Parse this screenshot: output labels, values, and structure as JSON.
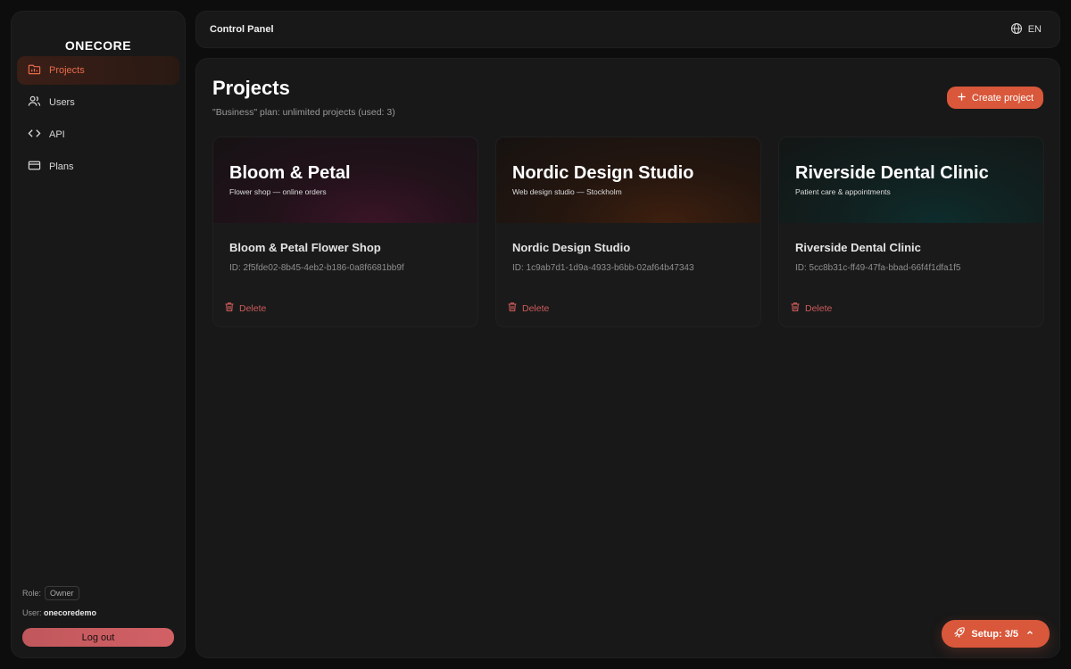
{
  "app": {
    "brand": "ONECORE"
  },
  "colors": {
    "accent": "#d9573a",
    "active_nav": "#ea6a4a",
    "danger": "#cf5b5b",
    "logout": "#c85d62"
  },
  "sidebar": {
    "items": [
      {
        "label": "Projects",
        "icon": "folder-icon",
        "active": true
      },
      {
        "label": "Users",
        "icon": "users-icon",
        "active": false
      },
      {
        "label": "API",
        "icon": "code-icon",
        "active": false
      },
      {
        "label": "Plans",
        "icon": "credit-card-icon",
        "active": false
      }
    ],
    "role_label": "Role:",
    "role_value": "Owner",
    "user_label": "User:",
    "user_value": "onecoredemo",
    "logout_label": "Log out"
  },
  "topbar": {
    "title": "Control Panel",
    "language": "EN",
    "language_icon": "globe-icon"
  },
  "main": {
    "title": "Projects",
    "plan_info": "\"Business\" plan: unlimited projects (used: 3)",
    "create_label": "Create project",
    "projects": [
      {
        "banner_title": "Bloom & Petal",
        "banner_subtitle": "Flower shop — online orders",
        "name": "Bloom & Petal Flower Shop",
        "id_text": "ID: 2f5fde02-8b45-4eb2-b186-0a8f6681bb9f",
        "delete_label": "Delete",
        "banner_color": "#3a1426"
      },
      {
        "banner_title": "Nordic Design Studio",
        "banner_subtitle": "Web design studio — Stockholm",
        "name": "Nordic Design Studio",
        "id_text": "ID: 1c9ab7d1-1d9a-4933-b6bb-02af64b47343",
        "delete_label": "Delete",
        "banner_color": "#3e1f0f"
      },
      {
        "banner_title": "Riverside Dental Clinic",
        "banner_subtitle": "Patient care & appointments",
        "name": "Riverside Dental Clinic",
        "id_text": "ID: 5cc8b31c-ff49-47fa-bbad-66f4f1dfa1f5",
        "delete_label": "Delete",
        "banner_color": "#0e2c2c"
      }
    ]
  },
  "setup": {
    "label": "Setup: 3/5",
    "icon": "rocket-icon"
  }
}
